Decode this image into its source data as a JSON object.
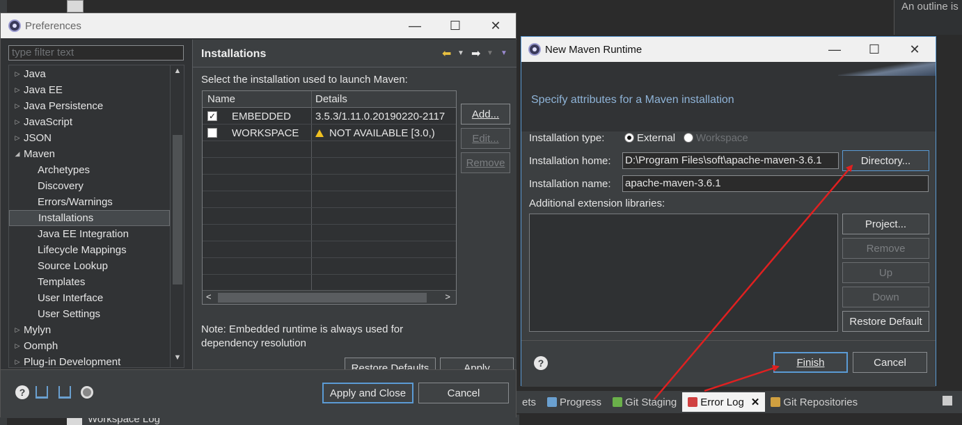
{
  "background": {
    "right_panel_text": "An outline is",
    "tabs": [
      {
        "label": "ets",
        "icon": "generic-view-icon"
      },
      {
        "label": "Progress",
        "icon": "progress-icon"
      },
      {
        "label": "Git Staging",
        "icon": "git-staging-icon"
      },
      {
        "label": "Error Log",
        "icon": "error-log-icon",
        "active": true
      },
      {
        "label": "Git Repositories",
        "icon": "git-repositories-icon"
      }
    ],
    "bottom_text": "Workspace Log"
  },
  "preferences": {
    "title": "Preferences",
    "filter_placeholder": "type filter text",
    "tree": [
      {
        "label": "Java",
        "level": 0,
        "arrow": "collapsed"
      },
      {
        "label": "Java EE",
        "level": 0,
        "arrow": "collapsed"
      },
      {
        "label": "Java Persistence",
        "level": 0,
        "arrow": "collapsed"
      },
      {
        "label": "JavaScript",
        "level": 0,
        "arrow": "collapsed"
      },
      {
        "label": "JSON",
        "level": 0,
        "arrow": "collapsed"
      },
      {
        "label": "Maven",
        "level": 0,
        "arrow": "expanded"
      },
      {
        "label": "Archetypes",
        "level": 1
      },
      {
        "label": "Discovery",
        "level": 1
      },
      {
        "label": "Errors/Warnings",
        "level": 1
      },
      {
        "label": "Installations",
        "level": 1,
        "selected": true
      },
      {
        "label": "Java EE Integration",
        "level": 1
      },
      {
        "label": "Lifecycle Mappings",
        "level": 1
      },
      {
        "label": "Source Lookup",
        "level": 1
      },
      {
        "label": "Templates",
        "level": 1
      },
      {
        "label": "User Interface",
        "level": 1
      },
      {
        "label": "User Settings",
        "level": 1
      },
      {
        "label": "Mylyn",
        "level": 0,
        "arrow": "collapsed"
      },
      {
        "label": "Oomph",
        "level": 0,
        "arrow": "collapsed"
      },
      {
        "label": "Plug-in Development",
        "level": 0,
        "arrow": "collapsed"
      }
    ],
    "pane_title": "Installations",
    "select_label": "Select the installation used to launch Maven:",
    "table": {
      "headers": [
        "Name",
        "Details"
      ],
      "rows": [
        {
          "checked": true,
          "name": "EMBEDDED",
          "details": "3.5.3/1.11.0.20190220-2117"
        },
        {
          "checked": false,
          "name": "WORKSPACE",
          "details": "NOT AVAILABLE [3.0,)",
          "warning": true
        }
      ]
    },
    "side_buttons": {
      "add": "Add...",
      "edit": "Edit...",
      "remove": "Remove"
    },
    "note": "Note: Embedded runtime is always used for dependency resolution",
    "restore_defaults": "Restore Defaults",
    "apply": "Apply",
    "apply_and_close": "Apply and Close",
    "cancel": "Cancel"
  },
  "maven": {
    "title": "New Maven Runtime",
    "banner": "Specify attributes for a Maven installation",
    "installation_type_label": "Installation type:",
    "type_external": "External",
    "type_workspace": "Workspace",
    "installation_home_label": "Installation home:",
    "installation_home_value": "D:\\Program Files\\soft\\apache-maven-3.6.1",
    "installation_name_label": "Installation name:",
    "installation_name_value": "apache-maven-3.6.1",
    "additional_label": "Additional extension libraries:",
    "directory_button": "Directory...",
    "project_button": "Project...",
    "remove_button": "Remove",
    "up_button": "Up",
    "down_button": "Down",
    "restore_default_button": "Restore Default",
    "finish_button": "Finish",
    "cancel_button": "Cancel"
  },
  "colors": {
    "annotation_arrow": "#e02020",
    "focus_border": "#5b9bd5",
    "banner_text": "#8fb4d8"
  }
}
